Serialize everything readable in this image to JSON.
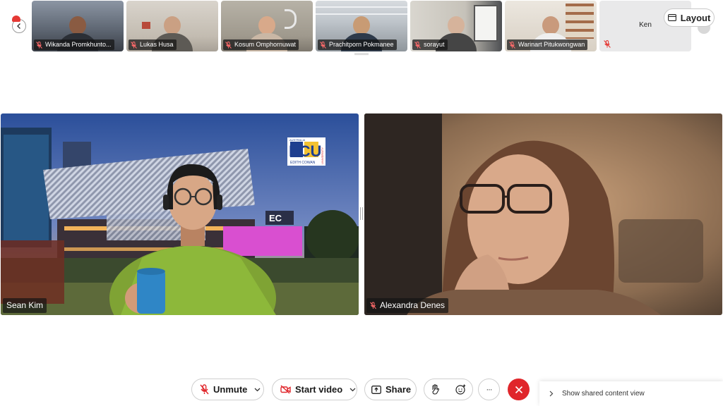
{
  "participants_strip": [
    {
      "name": "Wikanda Promkhunto...",
      "muted": true
    },
    {
      "name": "Lukas Husa",
      "muted": true
    },
    {
      "name": "Kosum Omphornuwat",
      "muted": true
    },
    {
      "name": "Prachitporn Pokmanee",
      "muted": true
    },
    {
      "name": "sorayut",
      "muted": true
    },
    {
      "name": "Warinart Pitukwongwan",
      "muted": true
    },
    {
      "name": "Ken",
      "muted": true
    }
  ],
  "layout_button": {
    "label": "Layout",
    "icon": "layout-icon"
  },
  "main_tiles": [
    {
      "name": "Sean Kim",
      "muted": false,
      "background_logo": "ECU",
      "background_sub": "EDITH COWAN",
      "background_side": "UNIVERSITY",
      "background_top": "AUSTRALIA"
    },
    {
      "name": "Alexandra Denes",
      "muted": true
    }
  ],
  "toolbar": {
    "unmute_label": "Unmute",
    "start_video_label": "Start video",
    "share_label": "Share",
    "more_label": "···"
  },
  "shared_content": {
    "label": "Show shared content view"
  },
  "colors": {
    "accent_red": "#e0262b",
    "mute_red": "#e53935",
    "tag_bg": "#141414"
  }
}
